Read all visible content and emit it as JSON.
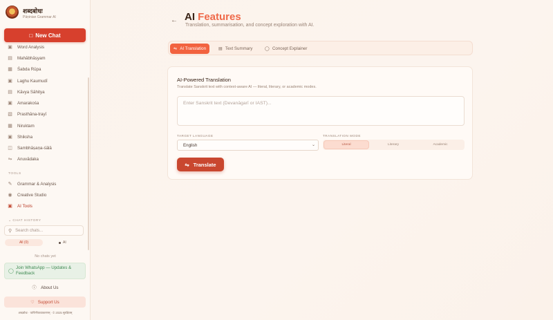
{
  "brand": {
    "name": "शब्दबोधः",
    "subtitle": "Pāṇinian Grammar AI"
  },
  "sidebar": {
    "new_chat": "New Chat",
    "nav_items": [
      {
        "label": "Word Analysis",
        "icon": "book-icon"
      },
      {
        "label": "Mahābhāṣyam",
        "icon": "open-book-icon"
      },
      {
        "label": "Śabda Rūpa",
        "icon": "table-icon"
      },
      {
        "label": "Laghu Kaumudī",
        "icon": "book-icon"
      },
      {
        "label": "Kāvya Sāhitya",
        "icon": "open-book-icon"
      },
      {
        "label": "Amarakośa",
        "icon": "book-icon"
      },
      {
        "label": "Prasthāna-trayī",
        "icon": "scroll-icon"
      },
      {
        "label": "Niruktam",
        "icon": "table-icon"
      },
      {
        "label": "Shiksha",
        "icon": "book-icon"
      },
      {
        "label": "Sambhāṣaṇa-śālā",
        "icon": "chat-icon"
      },
      {
        "label": "Anuvādaka",
        "icon": "translate-icon"
      }
    ],
    "tools_label": "TOOLS",
    "tools": [
      {
        "label": "Grammar & Analysis",
        "icon": "pen-icon"
      },
      {
        "label": "Creative Studio",
        "icon": "palette-icon"
      },
      {
        "label": "AI Tools",
        "icon": "briefcase-icon"
      }
    ],
    "chat_history_label": "CHAT HISTORY",
    "search_placeholder": "Search chats...",
    "filter_all": "All (0)",
    "filter_ai": "AI",
    "no_chats": "No chats yet",
    "whatsapp": "Join WhatsApp — Updates & Feedback",
    "about": "About Us",
    "support": "Support Us",
    "footer": "शब्दबोधः · पाणिनीयव्याकरणम् · © 2025 सुरक्षितम्"
  },
  "header": {
    "title_plain": "AI",
    "title_accent": "Features",
    "subtitle": "Translation, summarisation, and concept exploration with AI."
  },
  "tabs": [
    {
      "label": "AI Translation",
      "icon": "translate-icon"
    },
    {
      "label": "Text Summary",
      "icon": "document-icon"
    },
    {
      "label": "Concept Explainer",
      "icon": "bulb-icon"
    }
  ],
  "card": {
    "title": "AI-Powered Translation",
    "description": "Translate Sanskrit text with context-aware AI — literal, literary, or academic modes.",
    "source_placeholder": "Enter Sanskrit text (Devanāgarī or IAST)...",
    "target_label": "TARGET LANGUAGE",
    "target_value": "English",
    "mode_label": "TRANSLATION MODE",
    "modes": [
      "Literal",
      "Literary",
      "Academic"
    ],
    "translate_button": "Translate"
  },
  "colors": {
    "accent": "#f2623f",
    "primary_button": "#d7402d",
    "background": "#fbf3ec"
  }
}
